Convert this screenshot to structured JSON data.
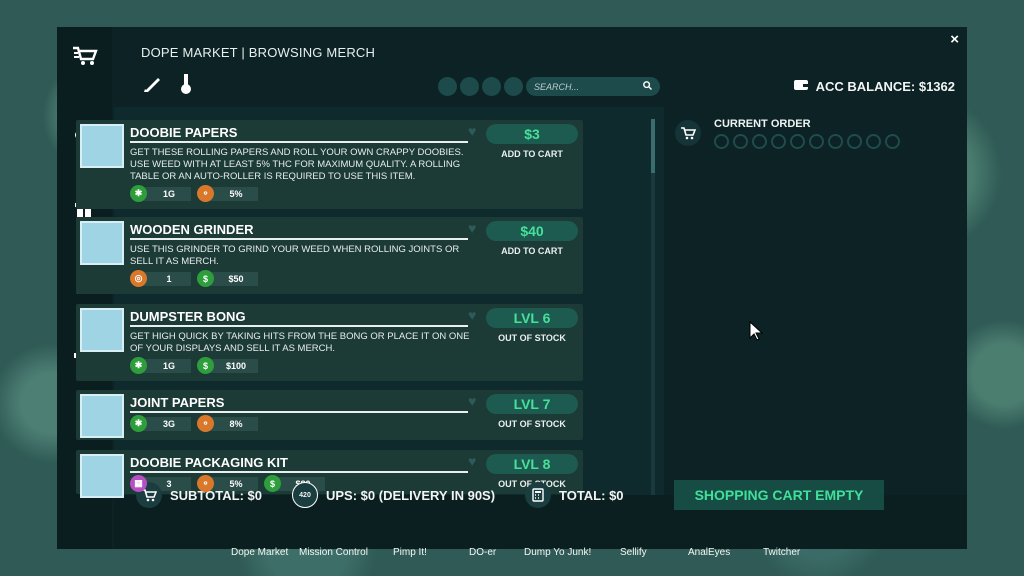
{
  "window": {
    "title": "DOPE MARKET | BROWSING  MERCH",
    "close_label": "×"
  },
  "rail": {
    "items": [
      {
        "icon": "cart-icon"
      },
      {
        "icon": "bud-icon"
      },
      {
        "icon": "spray-bottle-icon"
      },
      {
        "icon": "pots-icon"
      },
      {
        "icon": "list-icon"
      },
      {
        "icon": "puzzle-icon"
      },
      {
        "icon": "bong-icon"
      },
      {
        "icon": "gun-icon"
      }
    ]
  },
  "toolbar": {
    "search_placeholder": "SEARCH...",
    "balance_label": "ACC BALANCE: $1362"
  },
  "items": [
    {
      "name": "DOOBIE PAPERS",
      "description": "GET THESE ROLLING PAPERS AND ROLL YOUR OWN CRAPPY DOOBIES. USE WEED WITH AT LEAST 5% THC FOR MAXIMUM QUALITY. A ROLLING TABLE OR AN AUTO-ROLLER IS REQUIRED TO USE THIS ITEM.",
      "stats": [
        {
          "icon": "weed-leaf-icon",
          "value": "1G",
          "color": "#2e9e3c"
        },
        {
          "icon": "thc-molecule-icon",
          "value": "5%",
          "color": "#d9782a"
        }
      ],
      "price": "$3",
      "action": "ADD TO CART"
    },
    {
      "name": "WOODEN GRINDER",
      "description": "USE THIS GRINDER TO GRIND YOUR WEED WHEN ROLLING JOINTS OR SELL IT AS MERCH.",
      "stats": [
        {
          "icon": "grinder-icon",
          "value": "1",
          "color": "#d9782a"
        },
        {
          "icon": "dollar-icon",
          "value": "$50",
          "color": "#2e9e3c"
        }
      ],
      "price": "$40",
      "action": "ADD TO CART"
    },
    {
      "name": "DUMPSTER BONG",
      "description": "GET HIGH QUICK BY TAKING HITS FROM THE BONG OR PLACE IT ON ONE OF YOUR DISPLAYS AND SELL IT AS MERCH.",
      "stats": [
        {
          "icon": "weed-leaf-icon",
          "value": "1G",
          "color": "#2e9e3c"
        },
        {
          "icon": "dollar-icon",
          "value": "$100",
          "color": "#2e9e3c"
        }
      ],
      "price": "LVL 6",
      "action": "OUT OF STOCK"
    },
    {
      "name": "JOINT PAPERS",
      "description": "",
      "stats": [
        {
          "icon": "weed-leaf-icon",
          "value": "3G",
          "color": "#2e9e3c"
        },
        {
          "icon": "thc-molecule-icon",
          "value": "8%",
          "color": "#d9782a"
        }
      ],
      "price": "LVL 7",
      "action": "OUT OF STOCK"
    },
    {
      "name": "DOOBIE PACKAGING KIT",
      "description": "",
      "stats": [
        {
          "icon": "package-icon",
          "value": "3",
          "color": "#b44fc4"
        },
        {
          "icon": "thc-molecule-icon",
          "value": "5%",
          "color": "#d9782a"
        },
        {
          "icon": "dollar-icon",
          "value": "$80",
          "color": "#2e9e3c"
        }
      ],
      "price": "LVL 8",
      "action": "OUT OF STOCK"
    }
  ],
  "order": {
    "title": "CURRENT ORDER",
    "slot_count": 10
  },
  "footer": {
    "subtotal": "SUBTOTAL: $0",
    "ups": "UPS: $0 (DELIVERY IN 90S)",
    "total": "TOTAL: $0",
    "cart_status": "SHOPPING CART EMPTY",
    "ups_badge": "420"
  },
  "taskbar": [
    "Dope Market",
    "Mission Control",
    "Pimp It!",
    "DO-er",
    "Dump Yo Junk!",
    "Sellify",
    "AnalEyes",
    "Twitcher"
  ],
  "colors": {
    "accent_green": "#47e09b",
    "panel": "#0c2224",
    "item_bg": "#1c3a36"
  }
}
